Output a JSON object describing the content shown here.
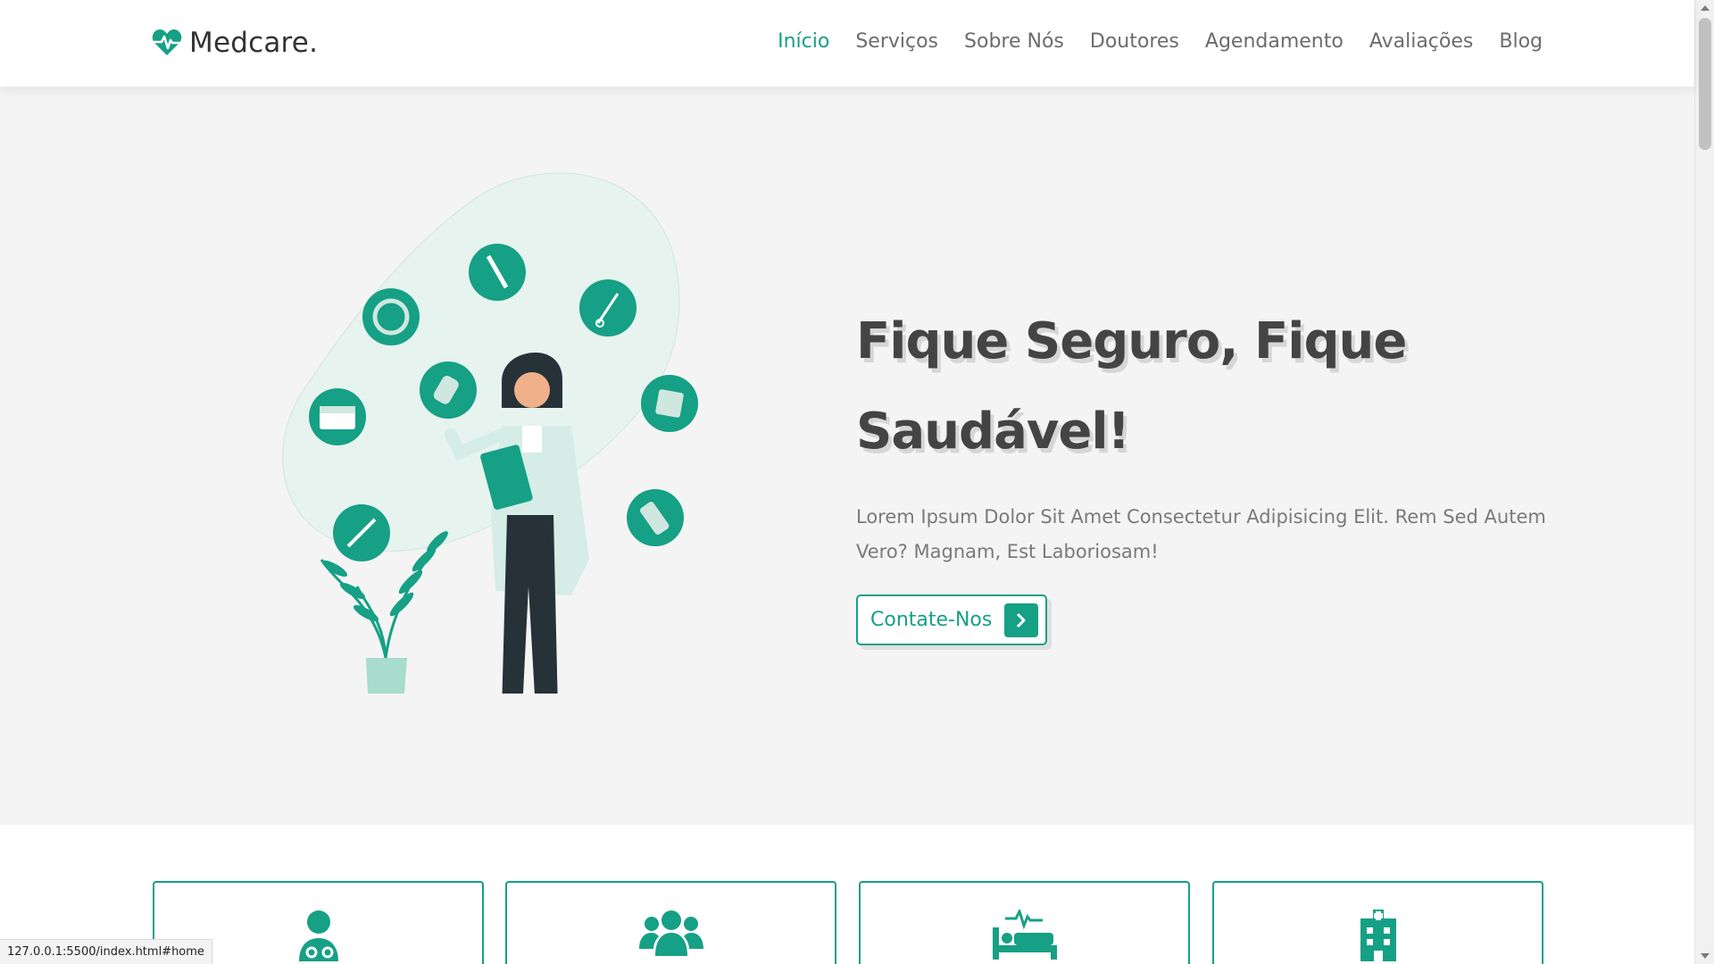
{
  "header": {
    "brand": "Medcare.",
    "nav": [
      {
        "label": "Início",
        "active": true
      },
      {
        "label": "Serviços",
        "active": false
      },
      {
        "label": "Sobre Nós",
        "active": false
      },
      {
        "label": "Doutores",
        "active": false
      },
      {
        "label": "Agendamento",
        "active": false
      },
      {
        "label": "Avaliações",
        "active": false
      },
      {
        "label": "Blog",
        "active": false
      }
    ]
  },
  "hero": {
    "title_line1": "Fique Seguro, Fique",
    "title_line2": "Saudável!",
    "description": "Lorem Ipsum Dolor Sit Amet Consectetur Adipisicing Elit. Rem Sed Autem Vero? Magnam, Est Laboriosam!",
    "cta_label": "Contate-Nos"
  },
  "icons": [
    {
      "icon": "user-doctor-icon"
    },
    {
      "icon": "users-icon"
    },
    {
      "icon": "procedures-icon"
    },
    {
      "icon": "hospital-icon"
    }
  ],
  "statusbar": {
    "url": "127.0.0.1:5500/index.html#home"
  },
  "colors": {
    "accent": "#16a085",
    "text": "#444444",
    "muted": "#7a7a7a",
    "bg": "#f4f4f4"
  }
}
